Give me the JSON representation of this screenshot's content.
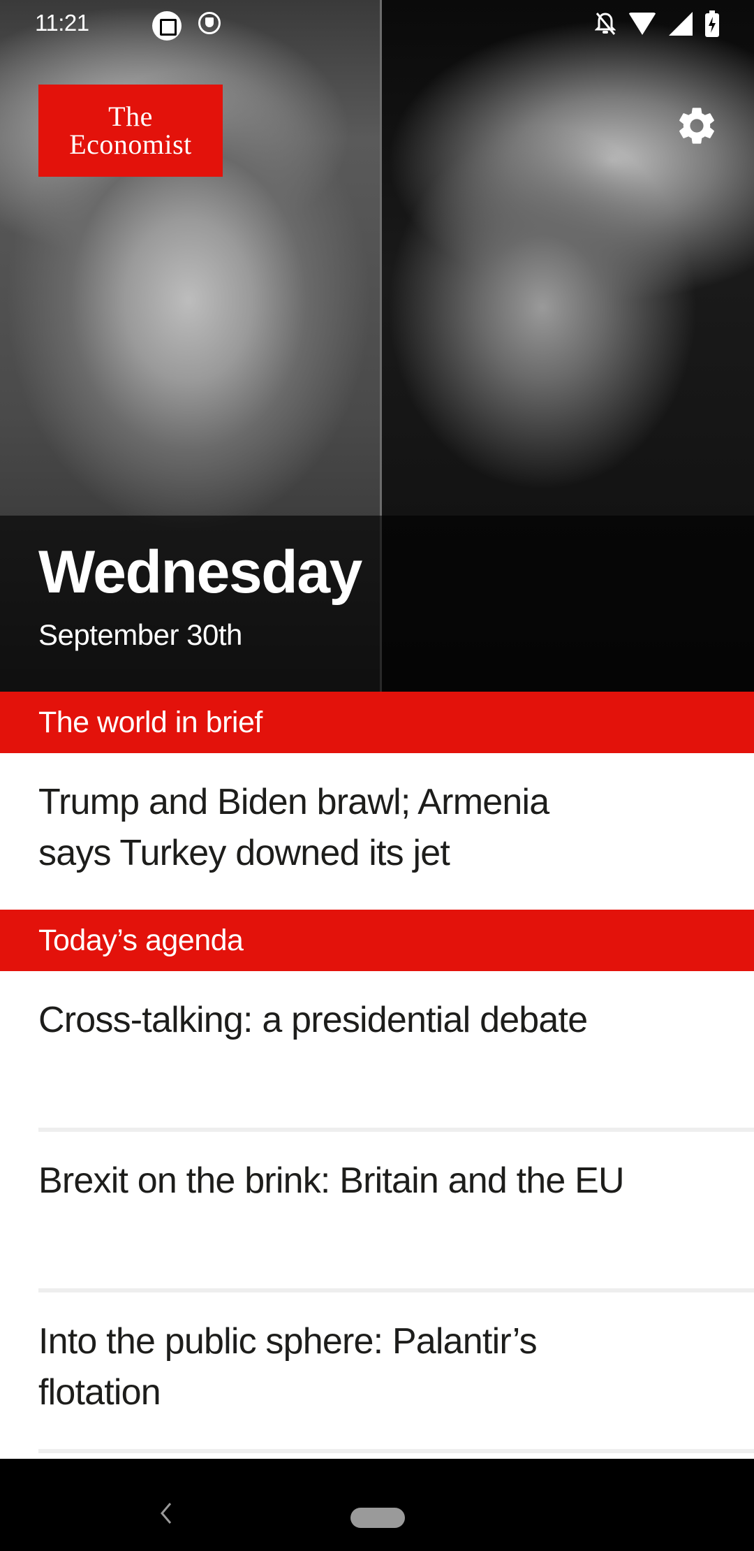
{
  "status_bar": {
    "time": "11:21",
    "left_icons": [
      "screenshot-edit-icon",
      "vpn-shield-icon"
    ],
    "right_icons": [
      "notifications-off-icon",
      "wifi-icon",
      "cellular-signal-icon",
      "battery-charging-icon"
    ]
  },
  "app": {
    "logo_line1": "The",
    "logo_line2": "Economist",
    "brand_color": "#e3120b",
    "settings_icon": "gear-icon"
  },
  "hero": {
    "day": "Wednesday",
    "date": "September 30th",
    "image_description": "Split black-and-white portraits facing each other"
  },
  "sections": [
    {
      "title": "The world in brief",
      "items": [
        {
          "headline": "Trump and Biden brawl; Armenia says Turkey downed its jet"
        }
      ]
    },
    {
      "title": "Today’s agenda",
      "items": [
        {
          "headline": "Cross-talking: a presidential debate"
        },
        {
          "headline": "Brexit on the brink: Britain and the EU"
        },
        {
          "headline": "Into the public sphere: Palantir’s flotation"
        }
      ]
    }
  ],
  "nav_bar": {
    "back_icon": "back-chevron-icon",
    "home_icon": "home-pill-icon"
  }
}
